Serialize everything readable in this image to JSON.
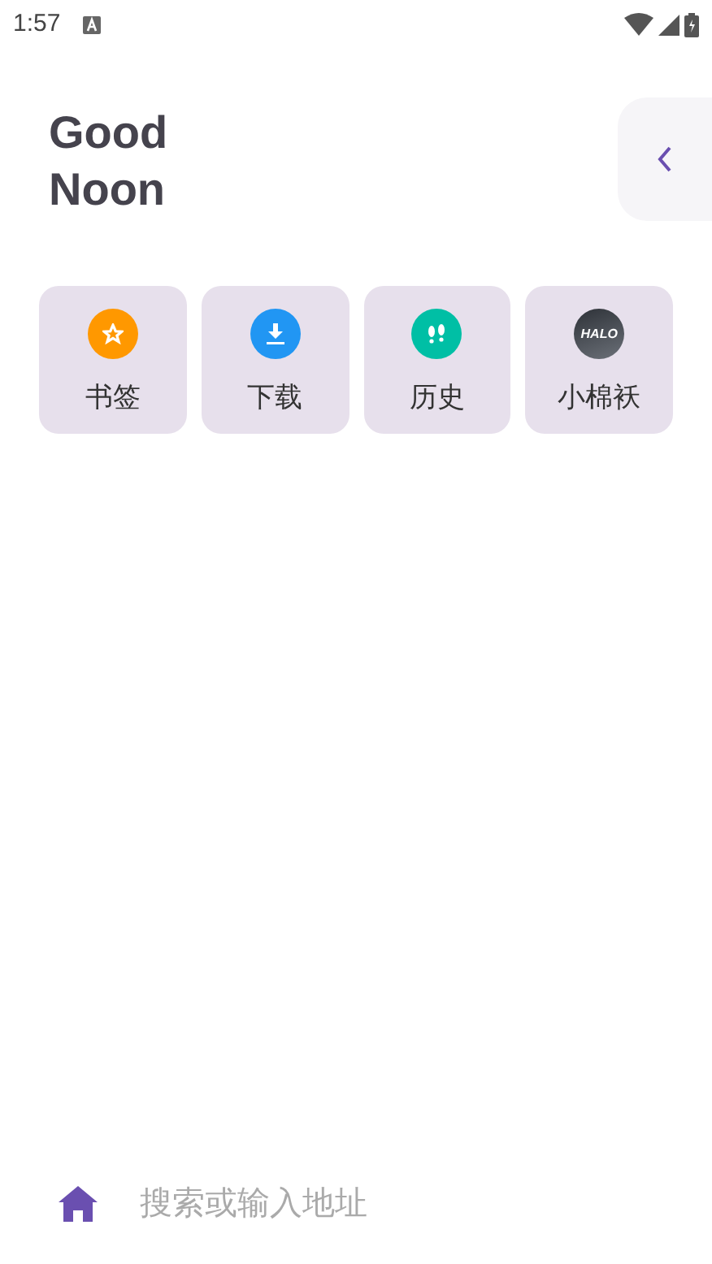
{
  "status_bar": {
    "time": "1:57"
  },
  "greeting": {
    "line_1": "Good",
    "line_2": "Noon"
  },
  "shortcuts": [
    {
      "label": "书签",
      "kind": "star",
      "color": "#ff9800"
    },
    {
      "label": "下载",
      "kind": "download",
      "color": "#2196f3"
    },
    {
      "label": "历史",
      "kind": "footprints",
      "color": "#00bfa5"
    },
    {
      "label": "小棉袄",
      "kind": "logo",
      "logo_text": "HALO"
    }
  ],
  "bottom_bar": {
    "placeholder": "搜索或输入地址"
  }
}
